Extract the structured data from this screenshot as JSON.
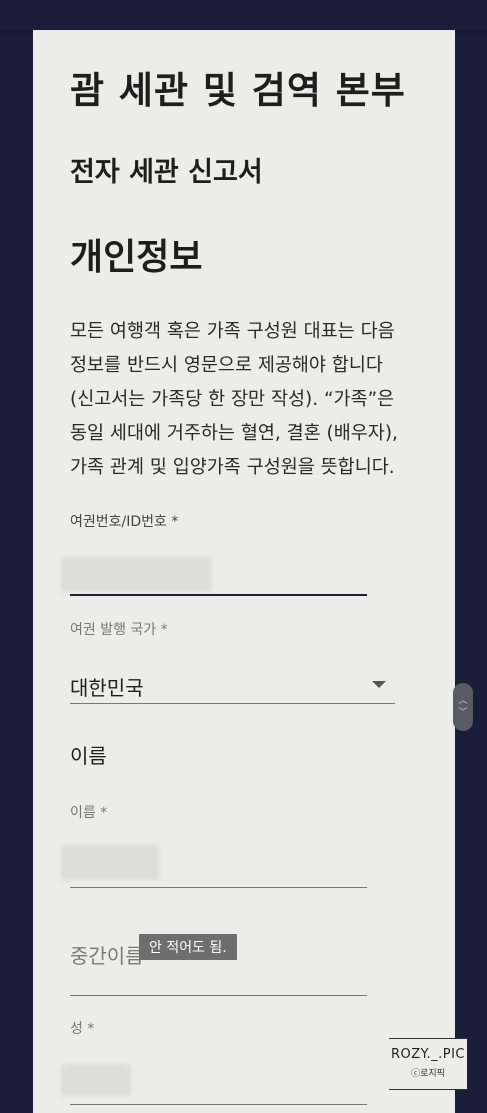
{
  "header": {
    "agency_title": "괌 세관 및 검역 본부",
    "form_title": "전자 세관 신고서",
    "section_title": "개인정보"
  },
  "intro": "모든 여행객 혹은 가족 구성원 대표는 다음 정보를 반드시 영문으로 제공해야 합니다 (신고서는 가족당 한 장만 작성). “가족”은 동일 세대에 거주하는 혈연, 결혼 (배우자), 가족 관계 및 입양가족 구성원을 뜻합니다.",
  "fields": {
    "passport": {
      "label": "여권번호/ID번호 *",
      "value": ""
    },
    "issuing_country": {
      "label": "여권 발행 국가 *",
      "value": "대한민국"
    },
    "name_section": "이름",
    "first_name": {
      "label": "이름 *",
      "value": ""
    },
    "middle_name": {
      "placeholder": "중간이름",
      "value": ""
    },
    "last_name": {
      "label": "성 *",
      "value": ""
    }
  },
  "annotation": "안 적어도 됨.",
  "watermark": {
    "title": "ROZY._.PIC",
    "sub": "ⓒ로지픽"
  },
  "colors": {
    "background": "#1b1e3b",
    "card": "#ececea",
    "active_underline": "#1c2140"
  }
}
